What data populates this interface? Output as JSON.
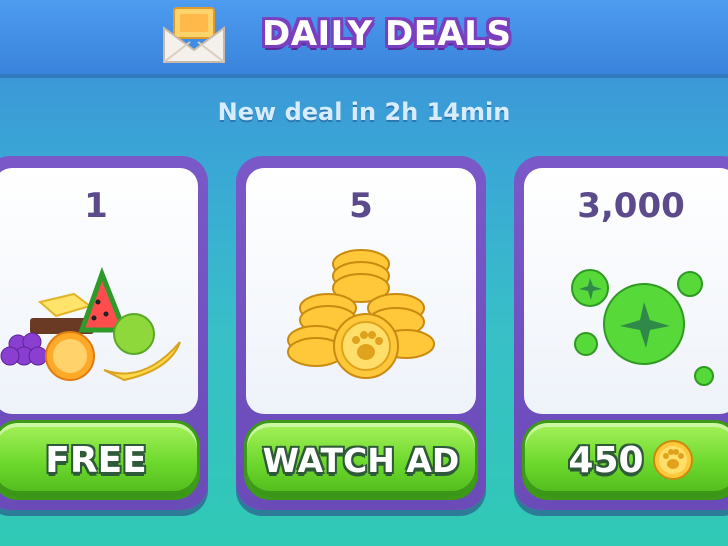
{
  "header": {
    "title": "DAILY DEALS",
    "icon": "envelope-icon"
  },
  "countdown": "New deal in 2h 14min",
  "deals": [
    {
      "quantity": "1",
      "item": "fruit-basket",
      "button_label": "FREE"
    },
    {
      "quantity": "5",
      "item": "paw-coin-stack",
      "button_label": "WATCH AD"
    },
    {
      "quantity": "3,000",
      "item": "green-plane-bubbles",
      "button_label": "450",
      "price_icon": "paw-coin-icon"
    }
  ],
  "colors": {
    "header_bg": "#3a83dc",
    "title_outline": "#7a3fbf",
    "card_frame": "#6a4bb8",
    "button_green": "#6cd82c",
    "quantity_text": "#5b4a8c"
  }
}
